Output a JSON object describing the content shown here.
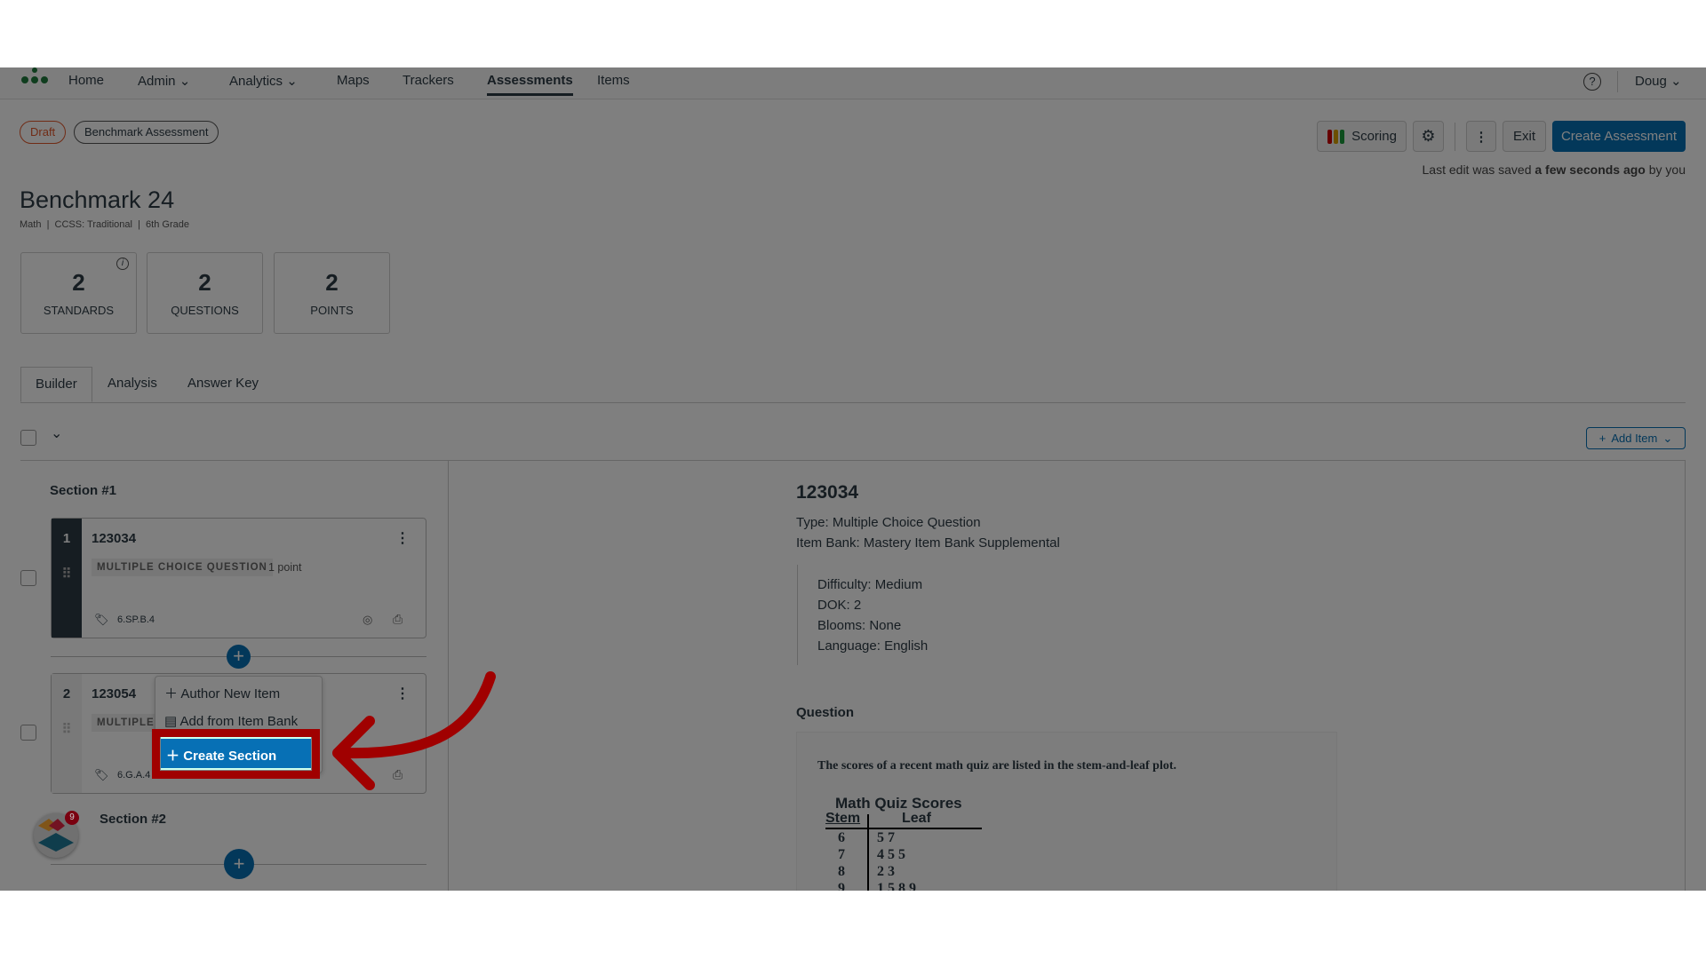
{
  "nav": {
    "items": [
      "Home",
      "Admin",
      "Analytics",
      "Maps",
      "Trackers",
      "Assessments",
      "Items"
    ],
    "active": "Assessments",
    "user": "Doug"
  },
  "badges": {
    "status": "Draft",
    "type": "Benchmark Assessment"
  },
  "toolbar": {
    "scoring": "Scoring",
    "exit": "Exit",
    "create": "Create Assessment",
    "saved_prefix": "Last edit was saved",
    "saved_time": "a few seconds ago",
    "saved_suffix": "by you"
  },
  "assessment": {
    "title": "Benchmark 24",
    "meta": "Math  |  CCSS: Traditional  |  6th Grade"
  },
  "stats": [
    {
      "value": "2",
      "label": "STANDARDS"
    },
    {
      "value": "2",
      "label": "QUESTIONS"
    },
    {
      "value": "2",
      "label": "POINTS"
    }
  ],
  "tabs": [
    "Builder",
    "Analysis",
    "Answer Key"
  ],
  "add_item": "Add Item",
  "sections": [
    {
      "title": "Section #1"
    },
    {
      "title": "Section #2"
    }
  ],
  "items": [
    {
      "num": "1",
      "id": "123034",
      "type": "MULTIPLE CHOICE QUESTION",
      "points": "1 point",
      "standard": "6.SP.B.4"
    },
    {
      "num": "2",
      "id": "123054",
      "type": "MULTIPLE C",
      "standard": "6.G.A.4"
    }
  ],
  "menu": {
    "author": "Author New Item",
    "bank": "Add from Item Bank",
    "create_section": "Create Section"
  },
  "notification_count": "9",
  "detail": {
    "id": "123034",
    "type": "Type: Multiple Choice Question",
    "bank": "Item Bank: Mastery Item Bank Supplemental",
    "difficulty": "Difficulty: Medium",
    "dok": "DOK: 2",
    "blooms": "Blooms: None",
    "language": "Language: English",
    "question_label": "Question",
    "question_text": "The scores of a recent math quiz are listed in the stem-and-leaf plot.",
    "plot_title": "Math Quiz Scores",
    "stem_header": "Stem",
    "leaf_header": "Leaf",
    "rows": [
      {
        "stem": "6",
        "leaf": "5 7"
      },
      {
        "stem": "7",
        "leaf": "4 5 5"
      },
      {
        "stem": "8",
        "leaf": "2 3"
      },
      {
        "stem": "9",
        "leaf": "1 5 8 9"
      }
    ]
  },
  "colors": {
    "primary": "#0770b5",
    "highlight": "#a00000",
    "draft": "#e0572b"
  }
}
